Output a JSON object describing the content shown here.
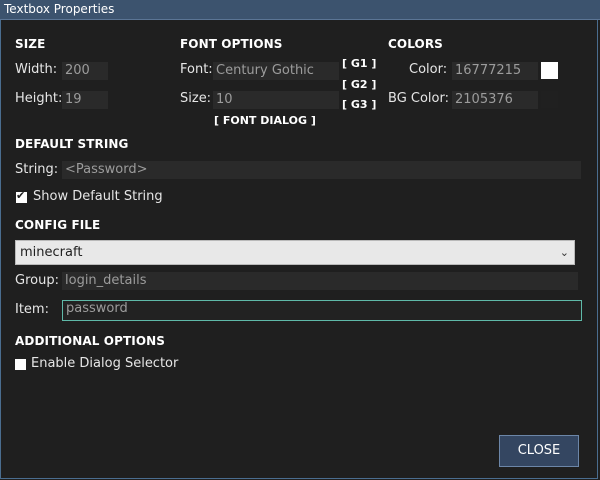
{
  "window": {
    "title": "Textbox Properties"
  },
  "size": {
    "heading": "SIZE",
    "width_label": "Width:",
    "width_value": "200",
    "height_label": "Height:",
    "height_value": "19"
  },
  "font_options": {
    "heading": "FONT OPTIONS",
    "font_label": "Font:",
    "font_value": "Century Gothic",
    "size_label": "Size:",
    "size_value": "10",
    "g1": "[ G1 ]",
    "g2": "[ G2 ]",
    "g3": "[ G3 ]",
    "font_dialog": "[ FONT DIALOG ]"
  },
  "colors": {
    "heading": "COLORS",
    "color_label": "Color:",
    "color_value": "16777215",
    "bg_color_label": "BG Color:",
    "bg_color_value": "2105376",
    "color_swatch": "#ffffff",
    "bg_swatch": "#202020"
  },
  "default_string": {
    "heading": "DEFAULT STRING",
    "string_label": "String:",
    "string_value": "<Password>",
    "show_label": "Show Default String",
    "show_checked": true
  },
  "config_file": {
    "heading": "CONFIG FILE",
    "selected": "minecraft",
    "group_label": "Group:",
    "group_value": "login_details",
    "item_label": "Item:",
    "item_value": "password"
  },
  "additional": {
    "heading": "ADDITIONAL OPTIONS",
    "enable_label": "Enable Dialog Selector",
    "enable_checked": false
  },
  "close_label": "CLOSE"
}
